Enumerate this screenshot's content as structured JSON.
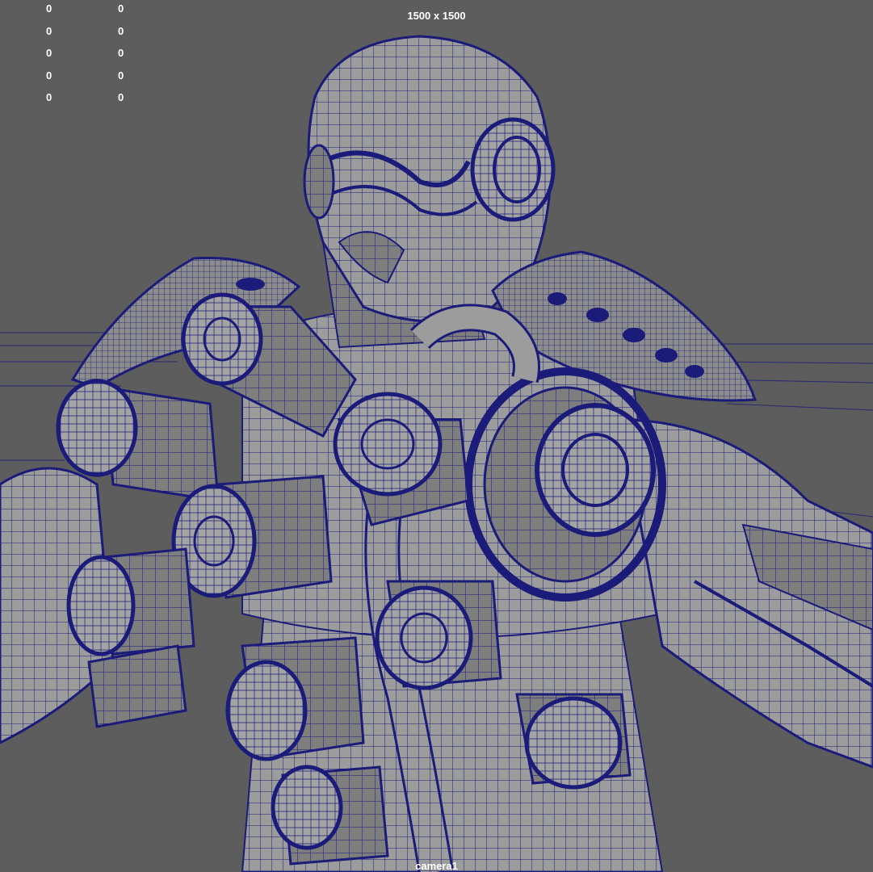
{
  "hud": {
    "left_col": [
      "0",
      "0",
      "0",
      "0",
      "0"
    ],
    "right_col": [
      "0",
      "0",
      "0",
      "0",
      "0"
    ],
    "resolution": "1500 x 1500",
    "camera": "camera1"
  },
  "colors": {
    "background": "#5d5d5d",
    "surface": "#9c9c9c",
    "surface_dark": "#808080",
    "wire": "#1b1b7a",
    "hud_text": "#ffffff"
  }
}
